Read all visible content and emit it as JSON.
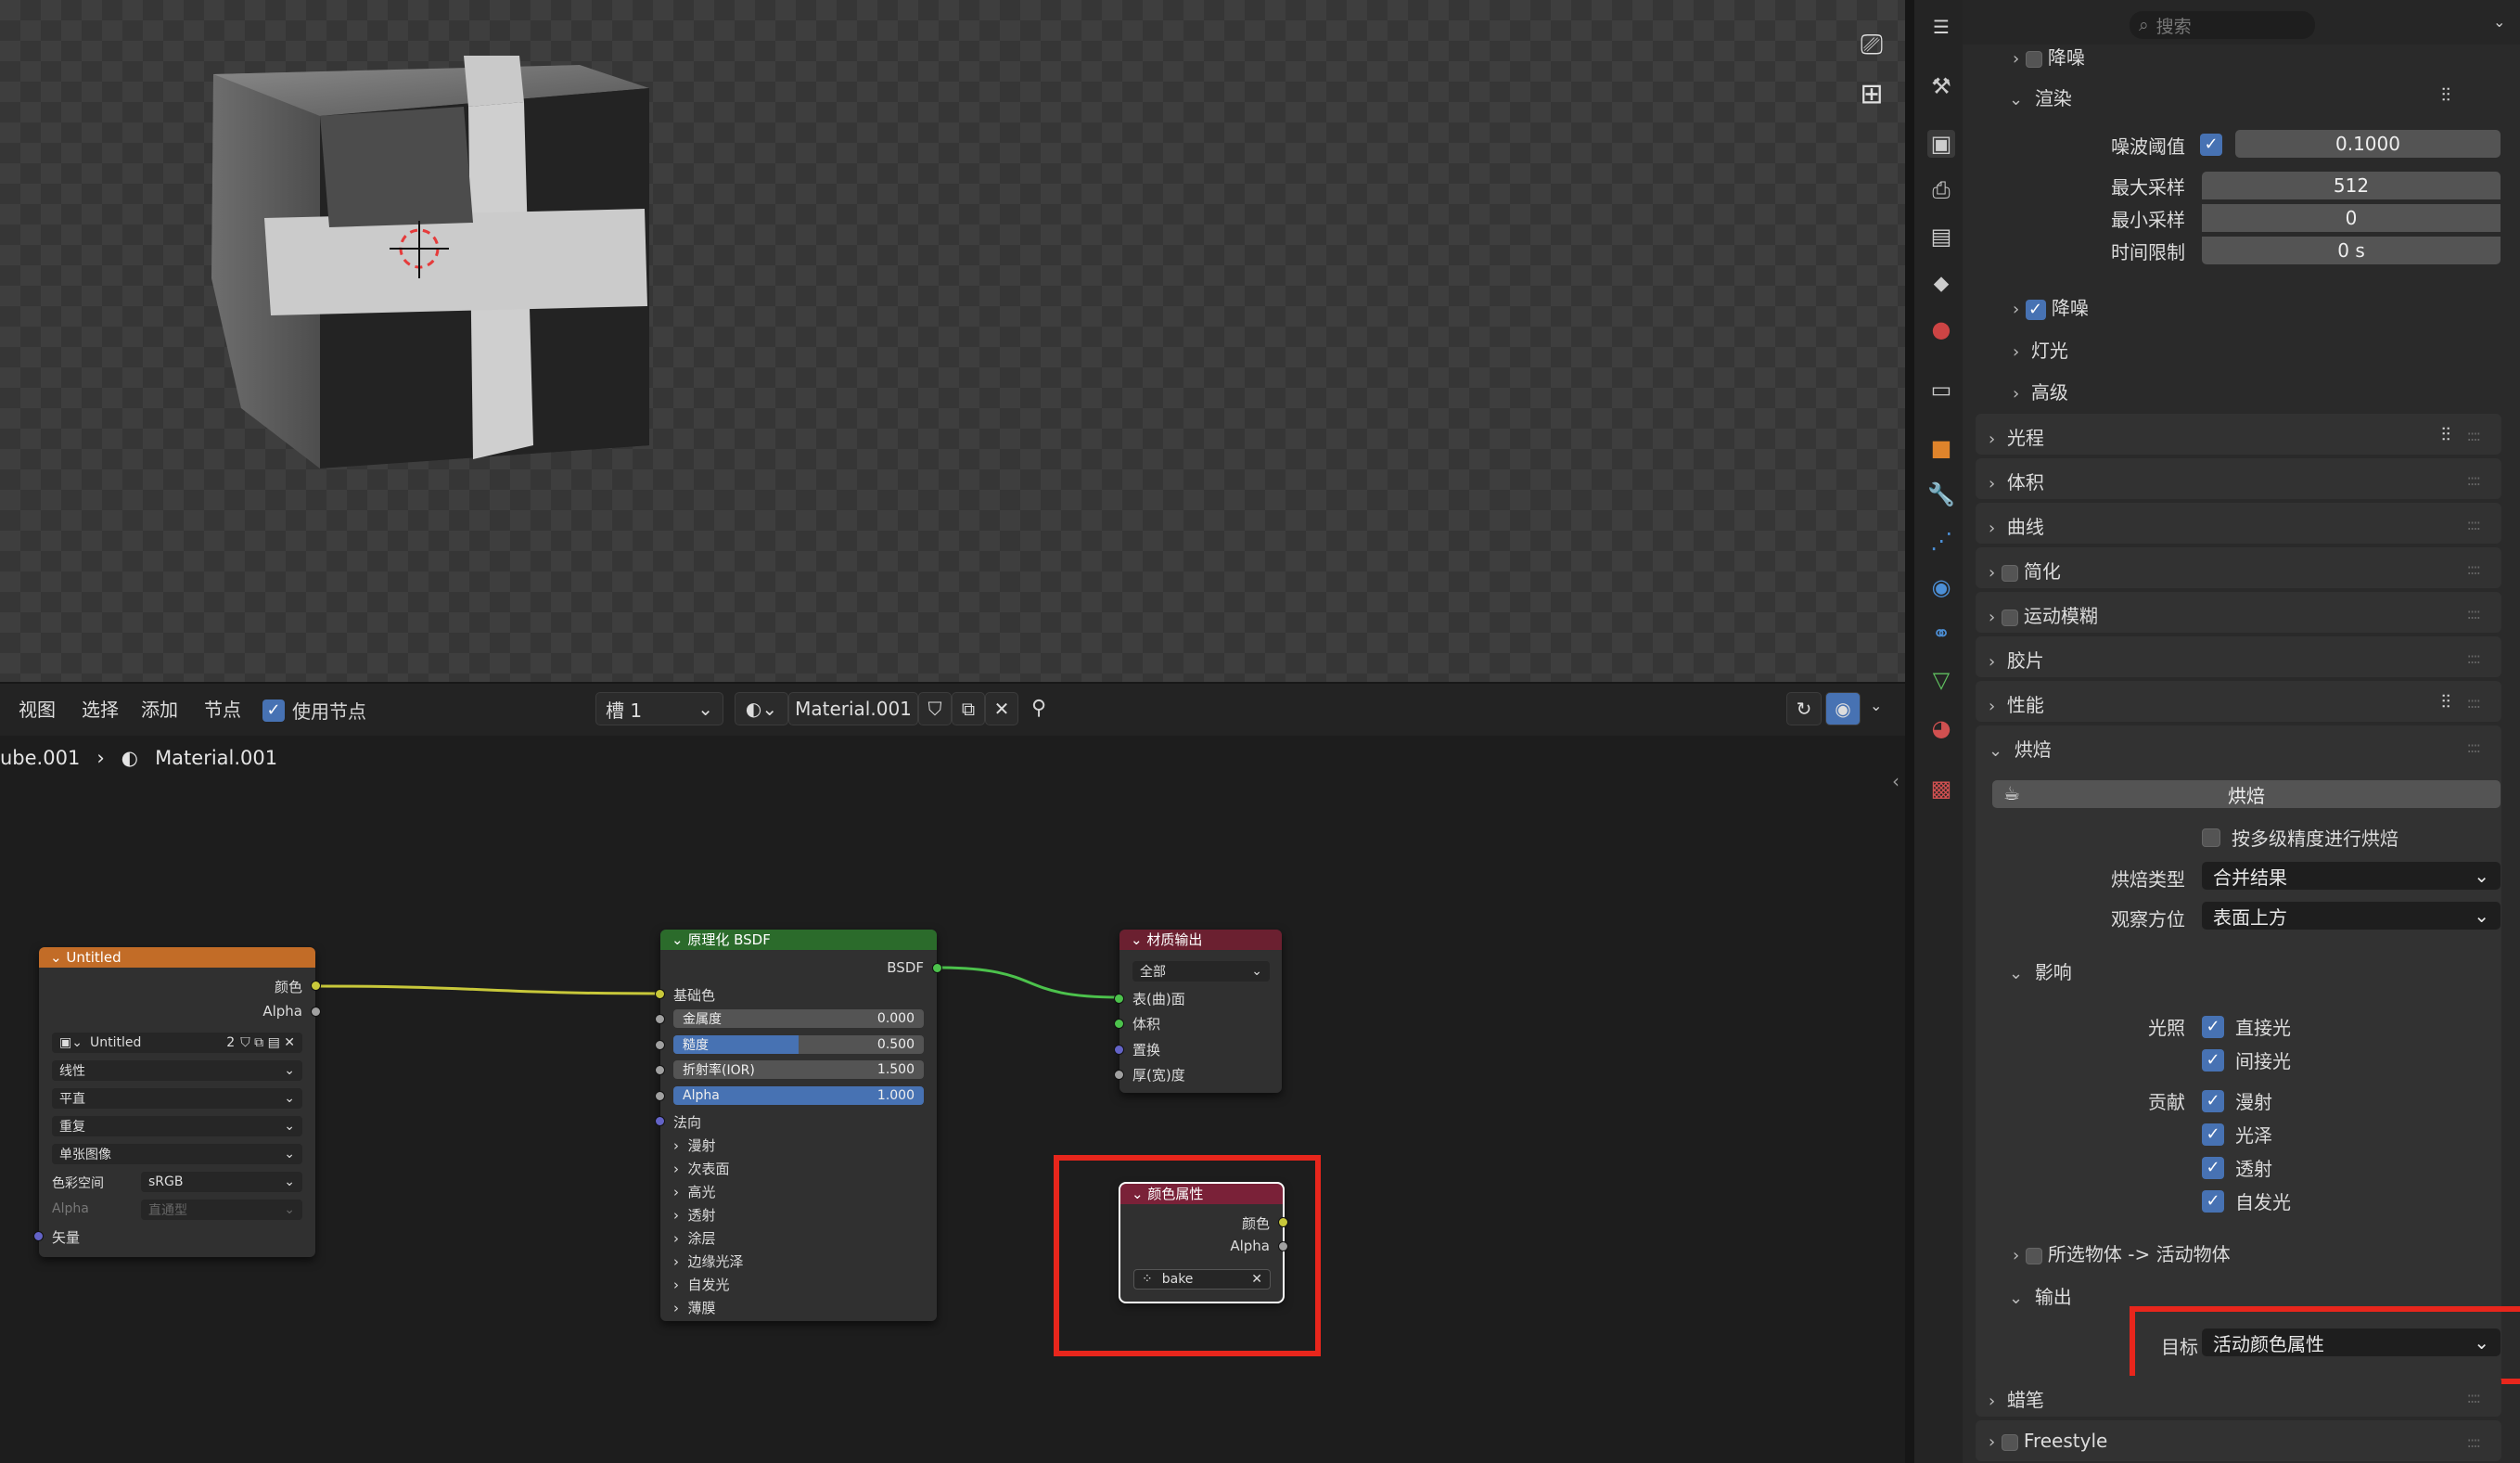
{
  "viewport": {
    "nav_icons": [
      "camera-icon",
      "grid-icon"
    ]
  },
  "node_header": {
    "view": "视图",
    "select": "选择",
    "add": "添加",
    "node": "节点",
    "use_nodes_label": "使用节点",
    "slot": "槽 1",
    "material": "Material.001"
  },
  "breadcrumb": {
    "object": "ube.001",
    "material": "Material.001"
  },
  "image_node": {
    "title": "Untitled",
    "out_color": "颜色",
    "out_alpha": "Alpha",
    "image_name": "Untitled",
    "users": "2",
    "interp": "线性",
    "proj": "平直",
    "ext": "重复",
    "src": "单张图像",
    "colorspace_label": "色彩空间",
    "colorspace": "sRGB",
    "alpha_label": "Alpha",
    "alpha_mode": "直通型",
    "in_vector": "矢量"
  },
  "bsdf_node": {
    "title": "原理化 BSDF",
    "out": "BSDF",
    "base_color": "基础色",
    "metallic_label": "金属度",
    "metallic": "0.000",
    "roughness_label": "糙度",
    "roughness": "0.500",
    "roughness_frac": 0.5,
    "ior_label": "折射率(IOR)",
    "ior": "1.500",
    "alpha_label": "Alpha",
    "alpha": "1.000",
    "normal": "法向",
    "panels": [
      "漫射",
      "次表面",
      "高光",
      "透射",
      "涂层",
      "边缘光泽",
      "自发光",
      "薄膜"
    ]
  },
  "output_node": {
    "title": "材质输出",
    "target": "全部",
    "surface": "表(曲)面",
    "volume": "体积",
    "displacement": "置换",
    "thickness": "厚(宽)度"
  },
  "attr_node": {
    "title": "颜色属性",
    "out_color": "颜色",
    "out_alpha": "Alpha",
    "attr_name": "bake"
  },
  "props": {
    "search_placeholder": "搜索",
    "top_denoise": "降噪",
    "render_section": "渲染",
    "noise_threshold_label": "噪波阈值",
    "noise_threshold": "0.1000",
    "max_samples_label": "最大采样",
    "max_samples": "512",
    "min_samples_label": "最小采样",
    "min_samples": "0",
    "time_limit_label": "时间限制",
    "time_limit": "0 s",
    "denoise": "降噪",
    "lights": "灯光",
    "advanced": "高级",
    "light_paths": "光程",
    "volumes": "体积",
    "curves": "曲线",
    "simplify": "简化",
    "motion_blur": "运动模糊",
    "film": "胶片",
    "performance": "性能",
    "bake_section": "烘焙",
    "bake_button": "烘焙",
    "multires_label": "按多级精度进行烘焙",
    "bake_type_label": "烘焙类型",
    "bake_type": "合并结果",
    "view_from_label": "观察方位",
    "view_from": "表面上方",
    "influence": "影响",
    "lighting_label": "光照",
    "direct": "直接光",
    "indirect": "间接光",
    "contrib_label": "贡献",
    "diffuse": "漫射",
    "glossy": "光泽",
    "transmission": "透射",
    "emit": "自发光",
    "selected_to_active": "所选物体 -> 活动物体",
    "output": "输出",
    "target_label": "目标",
    "target": "活动颜色属性",
    "grease_pencil": "蜡笔",
    "freestyle": "Freestyle"
  },
  "colors": {
    "accent": "#4772b3",
    "highlight": "#e8261c",
    "image_header": "#c26c27",
    "bsdf_header": "#2b6b2b",
    "output_header": "#6b2030",
    "attr_header": "#7a2138"
  }
}
